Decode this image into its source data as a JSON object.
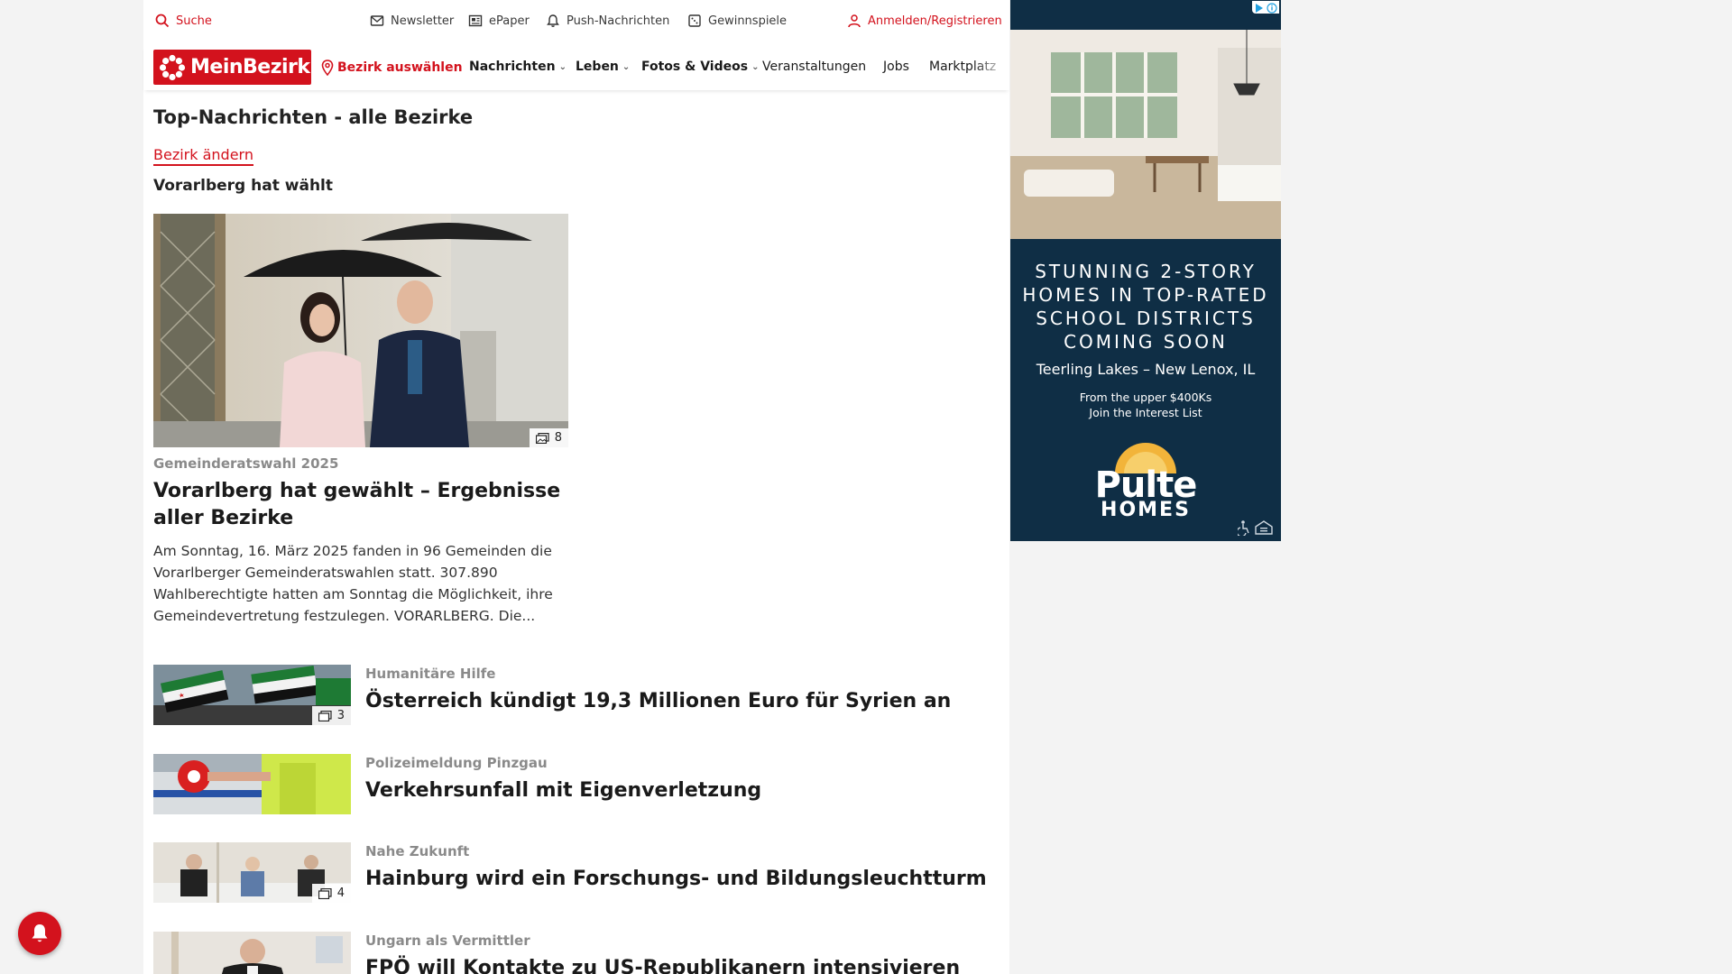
{
  "utilbar": {
    "search": "Suche",
    "newsletter": "Newsletter",
    "epaper": "ePaper",
    "push": "Push-Nachrichten",
    "contests": "Gewinnspiele",
    "login": "Anmelden/Registrieren"
  },
  "nav": {
    "logo": "MeinBezirk",
    "district": "Bezirk auswählen",
    "items": [
      {
        "label": "Nachrichten"
      },
      {
        "label": "Leben"
      },
      {
        "label": "Fotos & Videos"
      },
      {
        "label": "Veranstaltungen"
      },
      {
        "label": "Jobs"
      },
      {
        "label": "Marktplatz"
      }
    ]
  },
  "page": {
    "title": "Top-Nachrichten - alle Bezirke",
    "change_district": "Bezirk ändern",
    "section_title": "Vorarlberg hat wählt"
  },
  "hero": {
    "image_count": "8",
    "kicker": "Gemeinderatswahl 2025",
    "headline": "Vorarlberg hat gewählt – Ergebnisse aller Bezirke",
    "teaser": "Am Sonntag, 16. März 2025 fanden in 96 Gemeinden die Vorarlberger Gemeinderatswahlen statt. 307.890 Wahlberechtigte hatten am Sonntag die Möglichkeit, ihre Gemeindevertretung festzulegen. VORARLBERG. Die..."
  },
  "articles": [
    {
      "kicker": "Humanitäre Hilfe",
      "headline": "Österreich kündigt 19,3 Millionen Euro für Syrien an",
      "image_count": "3"
    },
    {
      "kicker": "Polizeimeldung Pinzgau",
      "headline": "Verkehrsunfall mit Eigenverletzung",
      "image_count": ""
    },
    {
      "kicker": "Nahe Zukunft",
      "headline": "Hainburg wird ein Forschungs- und Bildungsleuchtturm",
      "image_count": "4"
    },
    {
      "kicker": "Ungarn als Vermittler",
      "headline": "FPÖ will Kontakte zu US-Republikanern intensivieren",
      "image_count": ""
    }
  ],
  "ad": {
    "headline_lines": [
      "STUNNING 2-STORY",
      "HOMES IN TOP-RATED",
      "SCHOOL DISTRICTS",
      "COMING SOON"
    ],
    "location": "Teerling Lakes – New Lenox, IL",
    "price": "From the upper $400Ks",
    "cta": "Join the Interest List",
    "brand": "Pulte",
    "brand_sub": "HOMES"
  },
  "colors": {
    "brand_red": "#d3121d",
    "ad_navy": "#0f2e45"
  }
}
